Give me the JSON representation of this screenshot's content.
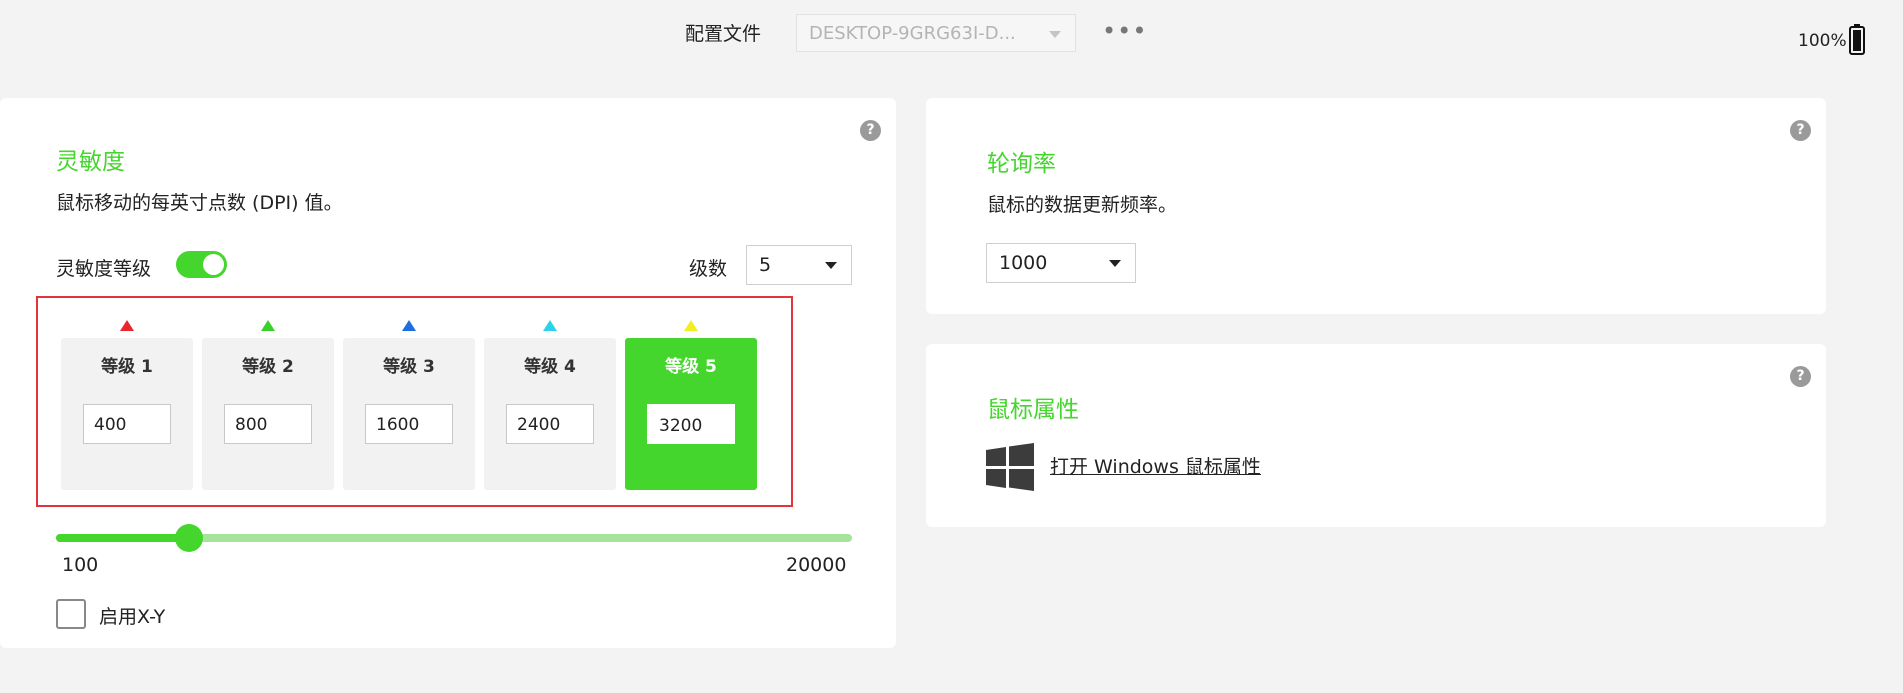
{
  "header": {
    "profile_label": "配置文件",
    "profile_value": "DESKTOP-9GRG63I-D...",
    "more_label": "•••",
    "battery_percent": "100%"
  },
  "sensitivity": {
    "title": "灵敏度",
    "description": "鼠标移动的每英寸点数 (DPI) 值。",
    "stages_label": "灵敏度等级",
    "stages_enabled": true,
    "count_label": "级数",
    "count_value": "5",
    "stages": [
      {
        "label": "等级 1",
        "value": "400",
        "marker_color": "#e8262e",
        "active": false
      },
      {
        "label": "等级 2",
        "value": "800",
        "marker_color": "#3ad12a",
        "active": false
      },
      {
        "label": "等级 3",
        "value": "1600",
        "marker_color": "#1d6ee0",
        "active": false
      },
      {
        "label": "等级 4",
        "value": "2400",
        "marker_color": "#2cd3e6",
        "active": false
      },
      {
        "label": "等级 5",
        "value": "3200",
        "marker_color": "#f3ee24",
        "active": true
      }
    ],
    "slider_min": "100",
    "slider_max": "20000",
    "slider_value": 3200,
    "xy_label": "启用X-Y",
    "xy_checked": false
  },
  "polling": {
    "title": "轮询率",
    "description": "鼠标的数据更新频率。",
    "value": "1000"
  },
  "mouse_properties": {
    "title": "鼠标属性",
    "link_label": "打开 Windows 鼠标属性"
  },
  "help_label": "?",
  "colors": {
    "accent": "#44d62c",
    "highlight_border": "#e2343a"
  },
  "icons": {
    "battery": "battery-icon",
    "help": "help-icon",
    "windows": "windows-logo-icon"
  }
}
